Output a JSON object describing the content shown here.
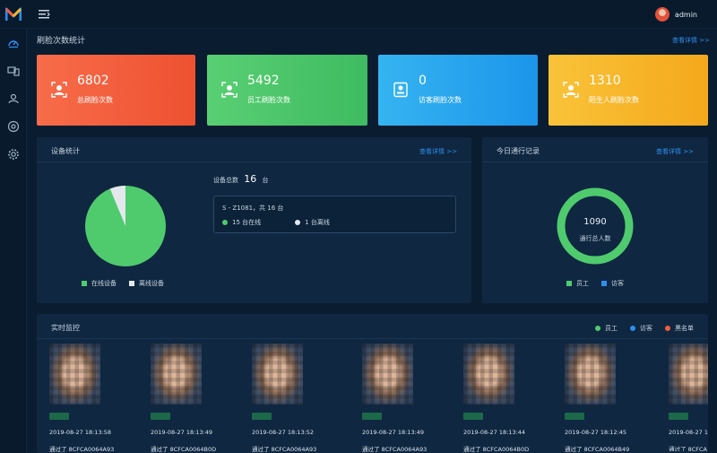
{
  "header": {
    "username": "admin"
  },
  "sidebar": {
    "items": [
      "dashboard-icon",
      "devices-icon",
      "people-icon",
      "monitor-icon",
      "settings-icon"
    ]
  },
  "page": {
    "title": "刷脸次数统计",
    "detail_link": "查看详情 >>"
  },
  "stats": [
    {
      "value": "6802",
      "label": "总刷脸次数",
      "color": "#f25f3c"
    },
    {
      "value": "5492",
      "label": "员工刷脸次数",
      "color": "#4bc56a"
    },
    {
      "value": "0",
      "label": "访客刷脸次数",
      "color": "#27a5ee"
    },
    {
      "value": "1310",
      "label": "陌生人刷脸次数",
      "color": "#f7b52b"
    }
  ],
  "device_panel": {
    "title": "设备统计",
    "link": "查看详情 >>",
    "total_label": "设备总数",
    "total_value": "16",
    "total_unit": "台",
    "device_name": "S - Z1081，共 16 台",
    "online_text": "15 台在线",
    "offline_text": "1 台离线",
    "legend_online": "在线设备",
    "legend_offline": "离线设备",
    "online": 15,
    "offline": 1,
    "online_color": "#4fcb6e",
    "offline_color": "#e4e8ee"
  },
  "today_panel": {
    "title": "今日通行记录",
    "link": "查看详情 >>",
    "total": "1090",
    "total_label": "通行总人数",
    "legend_employee": "员工",
    "legend_visitor": "访客",
    "employee_color": "#4fcb6e",
    "visitor_color": "#2d8ff0"
  },
  "monitor_panel": {
    "title": "实时监控",
    "legend": [
      {
        "label": "员工",
        "color": "#4fcb6e"
      },
      {
        "label": "访客",
        "color": "#2d8ff0"
      },
      {
        "label": "黑名单",
        "color": "#f25f3c"
      }
    ],
    "records": [
      {
        "time": "2019-08-27 18:13:58",
        "pass": "通过了 8CFCA0064A93"
      },
      {
        "time": "2019-08-27 18:13:49",
        "pass": "通过了 8CFCA0064B0D"
      },
      {
        "time": "2019-08-27 18:13:52",
        "pass": "通过了 8CFCA0064A93"
      },
      {
        "time": "2019-08-27 18:13:49",
        "pass": "通过了 8CFCA0064A93"
      },
      {
        "time": "2019-08-27 18:13:44",
        "pass": "通过了 8CFCA0064B0D"
      },
      {
        "time": "2019-08-27 18:12:45",
        "pass": "通过了 8CFCA0064B49"
      },
      {
        "time": "2019-08-27 18:13",
        "pass": "通过了 8CFCA"
      }
    ]
  }
}
